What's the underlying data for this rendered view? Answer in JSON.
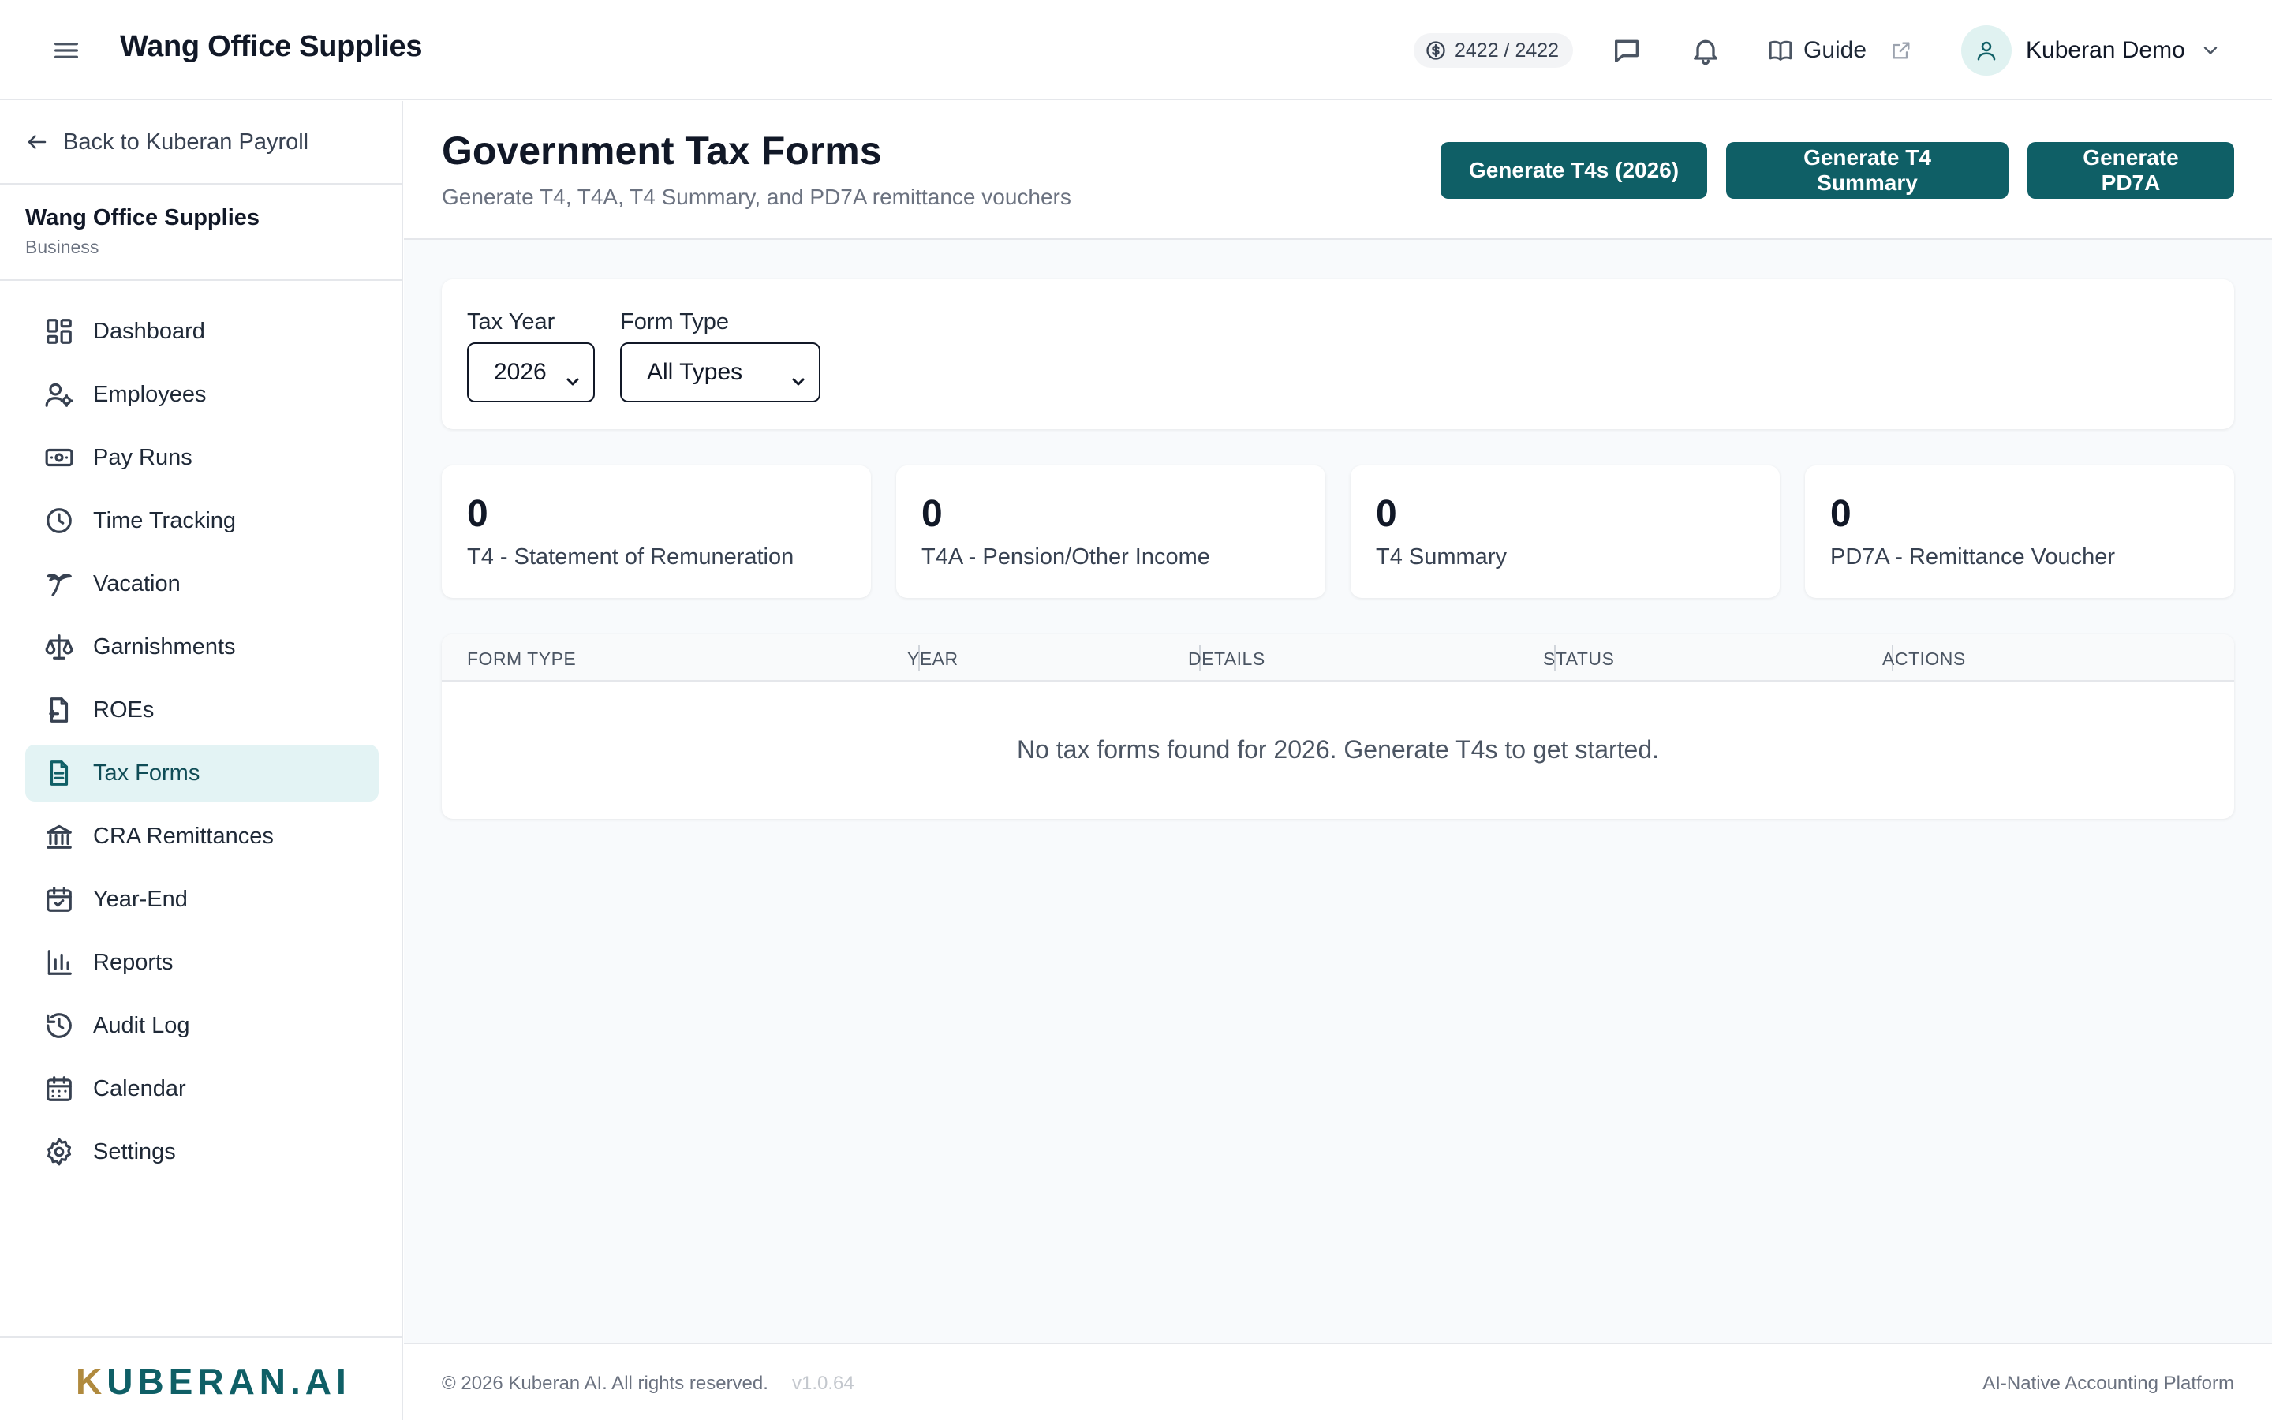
{
  "header": {
    "app_title": "Wang Office Supplies",
    "credits": "2422 / 2422",
    "guide_label": "Guide",
    "user_name": "Kuberan Demo"
  },
  "sidebar": {
    "back_label": "Back to Kuberan Payroll",
    "org_name": "Wang Office Supplies",
    "org_type": "Business",
    "items": [
      {
        "label": "Dashboard",
        "icon": "dashboard-icon"
      },
      {
        "label": "Employees",
        "icon": "user-gear-icon"
      },
      {
        "label": "Pay Runs",
        "icon": "banknote-icon"
      },
      {
        "label": "Time Tracking",
        "icon": "clock-icon"
      },
      {
        "label": "Vacation",
        "icon": "palm-tree-icon"
      },
      {
        "label": "Garnishments",
        "icon": "scale-icon"
      },
      {
        "label": "ROEs",
        "icon": "file-export-icon"
      },
      {
        "label": "Tax Forms",
        "icon": "file-text-icon",
        "active": true
      },
      {
        "label": "CRA Remittances",
        "icon": "bank-icon"
      },
      {
        "label": "Year-End",
        "icon": "calendar-check-icon"
      },
      {
        "label": "Reports",
        "icon": "bar-chart-icon"
      },
      {
        "label": "Audit Log",
        "icon": "history-icon"
      },
      {
        "label": "Calendar",
        "icon": "calendar-icon"
      },
      {
        "label": "Settings",
        "icon": "gear-icon"
      }
    ],
    "logo_prefix": "K",
    "logo_rest": "UBERAN.AI"
  },
  "page": {
    "title": "Government Tax Forms",
    "subtitle": "Generate T4, T4A, T4 Summary, and PD7A remittance vouchers",
    "buttons": {
      "t4s": "Generate T4s (2026)",
      "summary": "Generate T4 Summary",
      "pd7a": "Generate PD7A"
    }
  },
  "filters": {
    "tax_year_label": "Tax Year",
    "tax_year_value": "2026",
    "form_type_label": "Form Type",
    "form_type_value": "All Types"
  },
  "stats": [
    {
      "count": "0",
      "label": "T4 - Statement of Remuneration"
    },
    {
      "count": "0",
      "label": "T4A - Pension/Other Income"
    },
    {
      "count": "0",
      "label": "T4 Summary"
    },
    {
      "count": "0",
      "label": "PD7A - Remittance Voucher"
    }
  ],
  "table": {
    "columns": [
      "FORM TYPE",
      "YEAR",
      "DETAILS",
      "STATUS",
      "ACTIONS"
    ],
    "empty_message": "No tax forms found for 2026. Generate T4s to get started."
  },
  "footer": {
    "copyright": "© 2026 Kuberan AI. All rights reserved.",
    "version": "v1.0.64",
    "tagline": "AI-Native Accounting Platform"
  },
  "colors": {
    "accent": "#0f5f66",
    "active_bg": "#e3f3f4"
  }
}
